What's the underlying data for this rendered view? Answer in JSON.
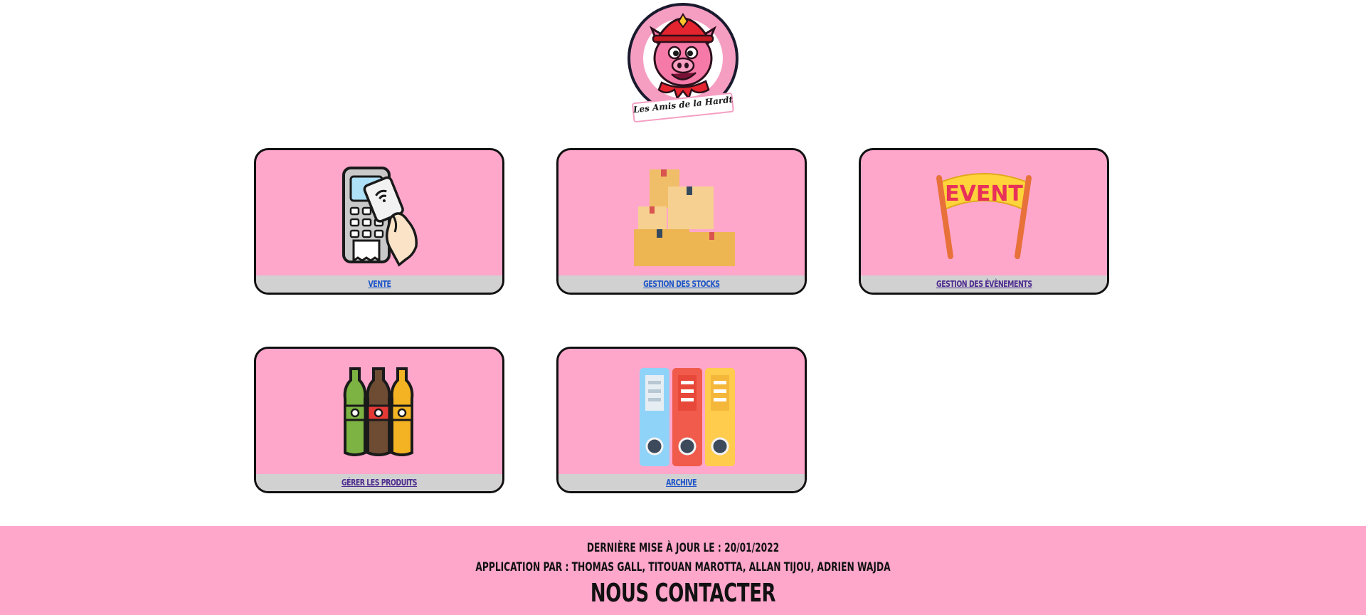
{
  "logo": {
    "text": "Les Amis de la Hardt",
    "icon": "pig-firefighter-logo-icon"
  },
  "cards": [
    {
      "label": "VENTE",
      "icon": "payment-terminal-icon",
      "link_state": "unvisited"
    },
    {
      "label": "GESTION DES STOCKS",
      "icon": "boxes-icon",
      "link_state": "unvisited"
    },
    {
      "label": "GESTION DES ÉVÈNEMENTS",
      "icon": "event-banner-icon",
      "link_state": "visited",
      "banner_text": "EVENT"
    },
    {
      "label": "GÉRER LES PRODUITS",
      "icon": "bottles-icon",
      "link_state": "visited"
    },
    {
      "label": "ARCHIVE",
      "icon": "binders-icon",
      "link_state": "unvisited"
    }
  ],
  "footer": {
    "updated": "DERNIÈRE MISE À JOUR LE : 20/01/2022",
    "authors": "APPLICATION PAR : THOMAS GALL, TITOUAN MAROTTA, ALLAN TIJOU, ADRIEN WAJDA",
    "contact": "NOUS CONTACTER"
  },
  "colors": {
    "pink": "#ffa6cb",
    "label_bar": "#d1d1d1",
    "link_blue": "#1f55c8",
    "link_visited": "#4d2c8f"
  }
}
